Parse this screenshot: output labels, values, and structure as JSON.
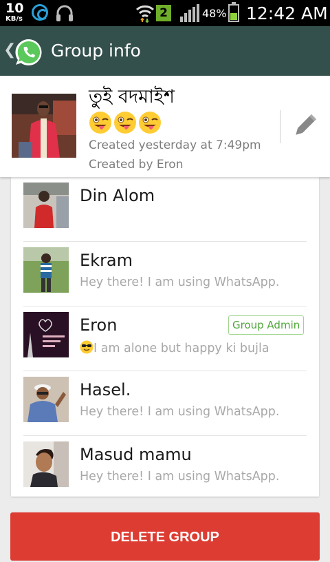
{
  "status_bar": {
    "speed_value": "10",
    "speed_unit": "KB/s",
    "sim_badge": "2",
    "battery_percent": "48%",
    "battery_level": 0.48,
    "time": "12:42 AM"
  },
  "action_bar": {
    "title": "Group info",
    "icons": [
      "back-chevron-icon",
      "whatsapp-logo-icon"
    ]
  },
  "group": {
    "name": "তুই বদমাইশ",
    "emojis": [
      "stuck-out-tongue-winking-eye",
      "stuck-out-tongue-winking-eye",
      "stuck-out-tongue-winking-eye"
    ],
    "created": "Created yesterday at 7:49pm",
    "creator": "Created by Eron",
    "edit_icon": "pencil-icon"
  },
  "members": [
    {
      "name": "Din Alom",
      "status": "",
      "admin": false
    },
    {
      "name": "Ekram",
      "status": "Hey there! I am using WhatsApp.",
      "admin": false
    },
    {
      "name": "Eron",
      "status": "I am alone but happy ki bujla",
      "status_emoji": "sunglasses-face",
      "admin": true,
      "admin_label": "Group Admin"
    },
    {
      "name": "Hasel.",
      "status": "Hey there! I am using WhatsApp.",
      "admin": false
    },
    {
      "name": "Masud mamu",
      "status": "Hey there! I am using WhatsApp.",
      "admin": false
    }
  ],
  "delete_button": {
    "label": "DELETE GROUP"
  },
  "colors": {
    "action_bar": "#34504c",
    "delete": "#dd3c32",
    "admin_badge": "#4ea53b"
  }
}
